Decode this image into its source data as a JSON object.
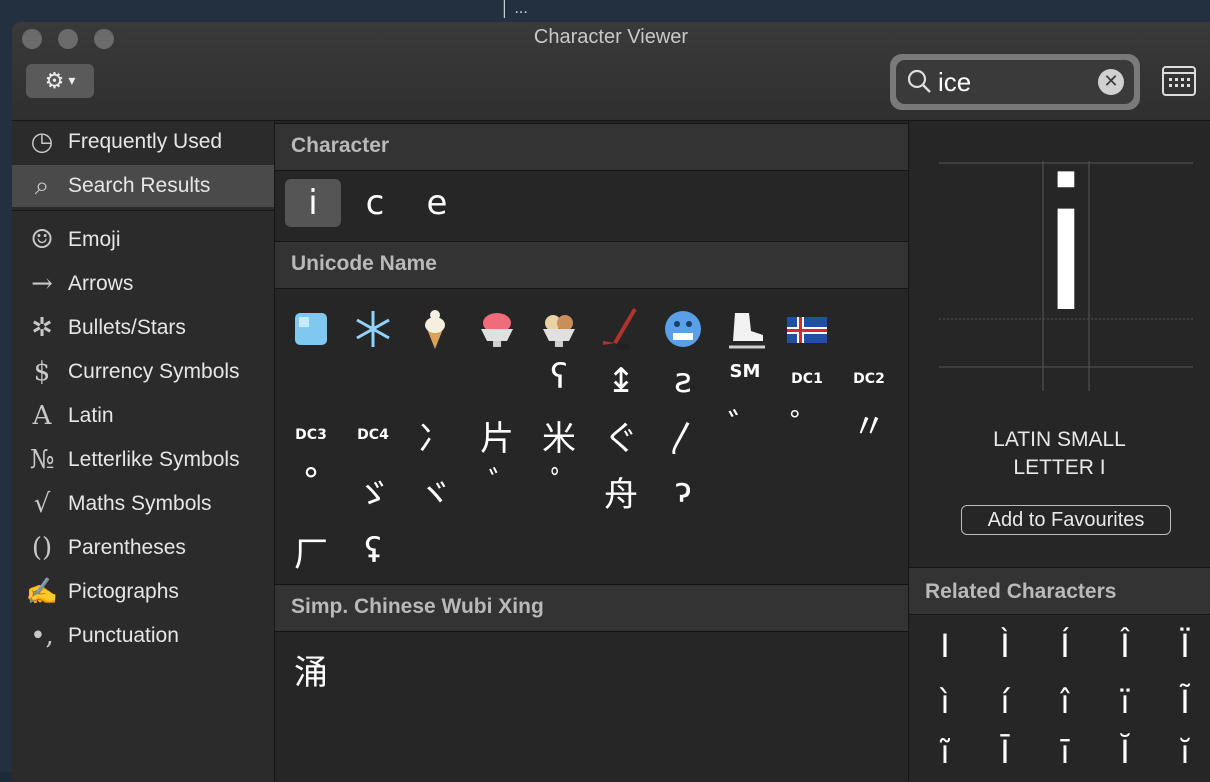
{
  "window": {
    "title": "Character Viewer"
  },
  "toolbar": {
    "gear_label": "⚙",
    "chevron": "⌄"
  },
  "search": {
    "value": "ice",
    "clear": "✕"
  },
  "sidebar": {
    "items": [
      {
        "icon": "clock-icon",
        "label": "Frequently Used",
        "glyph": "◷"
      },
      {
        "icon": "search-icon",
        "label": "Search Results",
        "glyph": "⌕",
        "selected": true
      },
      {
        "icon": "smiley-icon",
        "label": "Emoji",
        "glyph": "☺"
      },
      {
        "icon": "arrow-icon",
        "label": "Arrows",
        "glyph": "→"
      },
      {
        "icon": "asterisk-icon",
        "label": "Bullets/Stars",
        "glyph": "✲"
      },
      {
        "icon": "dollar-icon",
        "label": "Currency Symbols",
        "glyph": "$"
      },
      {
        "icon": "latin-a-icon",
        "label": "Latin",
        "glyph": "A"
      },
      {
        "icon": "numero-icon",
        "label": "Letterlike Symbols",
        "glyph": "№"
      },
      {
        "icon": "sqrt-icon",
        "label": "Maths Symbols",
        "glyph": "√"
      },
      {
        "icon": "parentheses-icon",
        "label": "Parentheses",
        "glyph": "()"
      },
      {
        "icon": "writing-hand-icon",
        "label": "Pictographs",
        "glyph": "✍"
      },
      {
        "icon": "punctuation-icon",
        "label": "Punctuation",
        "glyph": "•,"
      }
    ]
  },
  "sections": {
    "character": {
      "title": "Character",
      "chars": [
        "i",
        "c",
        "e"
      ]
    },
    "unicode_name": {
      "title": "Unicode Name",
      "emoji": [
        "ice-cube",
        "snowflake",
        "soft-ice-cream",
        "shaved-ice",
        "ice-cream",
        "ice-hockey",
        "cold-face",
        "ice-skate",
        "iceland-flag"
      ],
      "row2": [
        "ʕ",
        "↨",
        "ƨ",
        "SM",
        "DC1",
        "DC2"
      ],
      "row3": [
        "DC3",
        "DC4",
        "冫",
        "片",
        "米",
        "ぐ",
        "〳",
        "゛",
        "゜",
        "〃"
      ],
      "row4": [
        "°",
        "ゞ",
        "ヾ",
        "ﾞ",
        "ﾟ",
        "⾈",
        "ɂ"
      ],
      "row5": [
        "⼚",
        "ʢ"
      ]
    },
    "wubi": {
      "title": "Simp. Chinese Wubi Xing",
      "chars": [
        "涌"
      ]
    }
  },
  "detail": {
    "glyph": "i",
    "name_line1": "LATIN SMALL",
    "name_line2": "LETTER I",
    "fav_button": "Add to Favourites",
    "related_title": "Related Characters",
    "related": [
      "I",
      "Ì",
      "Í",
      "Î",
      "Ï",
      "ì",
      "í",
      "î",
      "ï",
      "Ĩ",
      "ĩ",
      "Ī",
      "ī",
      "Ĭ",
      "ĭ"
    ]
  }
}
